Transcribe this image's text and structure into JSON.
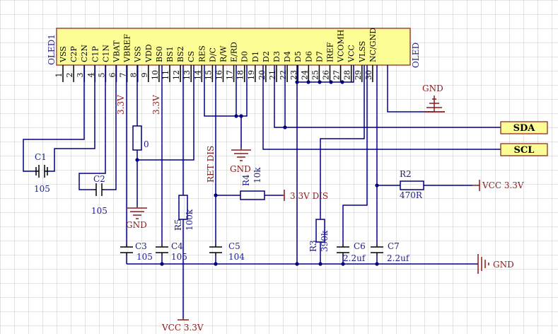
{
  "colors": {
    "chip_fill": "#fdfd96",
    "wire": "#000080",
    "power": "#8b1a1a",
    "label_text": "#1c1c8c",
    "port_fill": "#fdfd96"
  },
  "chip": {
    "designator": "OLED1",
    "name": "OLED",
    "pins": [
      {
        "num": "1",
        "name": "VSS"
      },
      {
        "num": "2",
        "name": "C2P"
      },
      {
        "num": "3",
        "name": "C2N"
      },
      {
        "num": "4",
        "name": "C1P"
      },
      {
        "num": "5",
        "name": "C1N"
      },
      {
        "num": "6",
        "name": "VBAT"
      },
      {
        "num": "7",
        "name": "VBREF"
      },
      {
        "num": "8",
        "name": "VSS"
      },
      {
        "num": "9",
        "name": "VDD"
      },
      {
        "num": "10",
        "name": "BS0"
      },
      {
        "num": "11",
        "name": "BS1"
      },
      {
        "num": "12",
        "name": "BS2"
      },
      {
        "num": "13",
        "name": "CS"
      },
      {
        "num": "14",
        "name": "RES"
      },
      {
        "num": "15",
        "name": "D/C"
      },
      {
        "num": "16",
        "name": "R/W"
      },
      {
        "num": "17",
        "name": "E/RD"
      },
      {
        "num": "18",
        "name": "D0"
      },
      {
        "num": "19",
        "name": "D1"
      },
      {
        "num": "20",
        "name": "D2"
      },
      {
        "num": "21",
        "name": "D3"
      },
      {
        "num": "22",
        "name": "D4"
      },
      {
        "num": "23",
        "name": "D5"
      },
      {
        "num": "24",
        "name": "D6"
      },
      {
        "num": "25",
        "name": "D7"
      },
      {
        "num": "26",
        "name": "IREF"
      },
      {
        "num": "27",
        "name": "VCOMH"
      },
      {
        "num": "28",
        "name": "VCC"
      },
      {
        "num": "29",
        "name": "VLSS"
      },
      {
        "num": "30",
        "name": "NC/GND"
      }
    ]
  },
  "ports": [
    {
      "label": "SDA"
    },
    {
      "label": "SCL"
    }
  ],
  "components": [
    {
      "ref": "C1",
      "value": "105"
    },
    {
      "ref": "C2",
      "value": "105"
    },
    {
      "ref": "C3",
      "value": "105"
    },
    {
      "ref": "C4",
      "value": "105"
    },
    {
      "ref": "C5",
      "value": "104"
    },
    {
      "ref": "C6",
      "value": "2.2uf"
    },
    {
      "ref": "C7",
      "value": "2.2uf"
    },
    {
      "ref": "R2",
      "value": "470R"
    },
    {
      "ref": "R3",
      "value": "390k"
    },
    {
      "ref": "R4",
      "value": "10k"
    },
    {
      "ref": "R5",
      "value": "100k"
    },
    {
      "ref": "",
      "value": "0"
    }
  ],
  "net_labels": {
    "v33_a": "3.3V",
    "v33_b": "3.3V",
    "ret_dis": "RET DIS",
    "dis_33": "3.3V DIS",
    "vcc_r2": "VCC 3.3V",
    "vcc_bottom": "VCC 3.3V",
    "gnd_top": "GND",
    "gnd_mid": "GND",
    "gnd_left": "GND",
    "gnd_right": "GND"
  }
}
